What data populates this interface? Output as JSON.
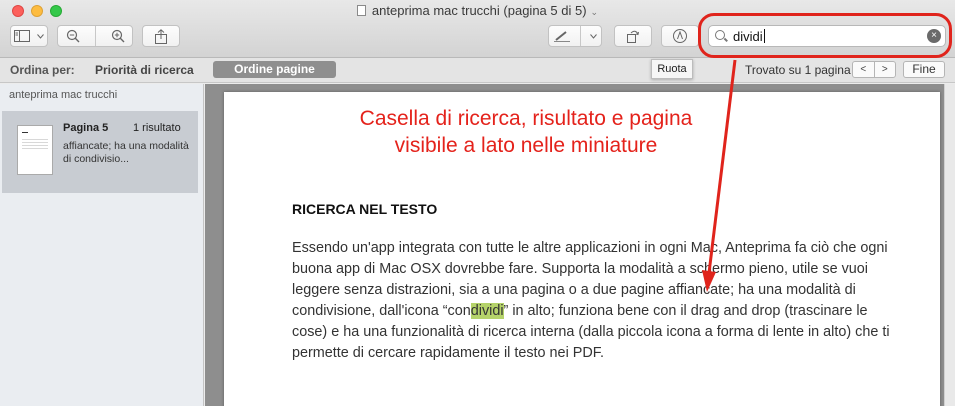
{
  "window": {
    "title": "anteprima mac trucchi (pagina 5 di 5)",
    "title_chevron": "⌄"
  },
  "toolbar": {
    "sidebar_button_icon": "sidebar-icon",
    "zoom_out_icon": "zoom-out-icon",
    "zoom_in_icon": "zoom-in-icon",
    "share_icon": "share-icon",
    "markup_icon": "highlighter-icon",
    "rotate_icon": "rotate-icon",
    "annotate_icon": "markup-pen-icon"
  },
  "search": {
    "value": "dividi",
    "clear_glyph": "×"
  },
  "sortbar": {
    "label": "Ordina per:",
    "option_priority": "Priorità di ricerca",
    "option_page_order": "Ordine pagine",
    "found_text": "Trovato su 1 pagina",
    "prev_glyph": "<",
    "next_glyph": ">",
    "done_label": "Fine"
  },
  "tooltip": {
    "text": "Ruota"
  },
  "sidebar": {
    "heading": "anteprima mac trucchi",
    "result": {
      "page": "Pagina 5",
      "count": "1 risultato",
      "snippet": "affiancate; ha una modalità di condivisio..."
    }
  },
  "annotation": {
    "line1": "Casella di ricerca, risultato e pagina",
    "line2": "visibile a lato nelle miniature",
    "color": "#e4221b"
  },
  "document": {
    "heading": "RICERCA NEL TESTO",
    "text_before": "Essendo un'app integrata con tutte le altre applicazioni in ogni Mac, Anteprima fa ciò che ogni buona app di Mac OSX dovrebbe fare. Supporta la modalità a schermo pieno, utile se vuoi leggere senza distrazioni, sia a una pagina o a due pagine affiancate; ha una modalità di condivisione, dall'icona “con",
    "highlight": "dividi",
    "text_after": "” in alto; funziona bene con il drag and drop (trascinare le cose) e ha una funzionalità di ricerca interna (dalla piccola icona a forma di lente in alto) che ti permette di cercare rapidamente il testo nei PDF.",
    "highlight_color": "#b5d36a"
  }
}
